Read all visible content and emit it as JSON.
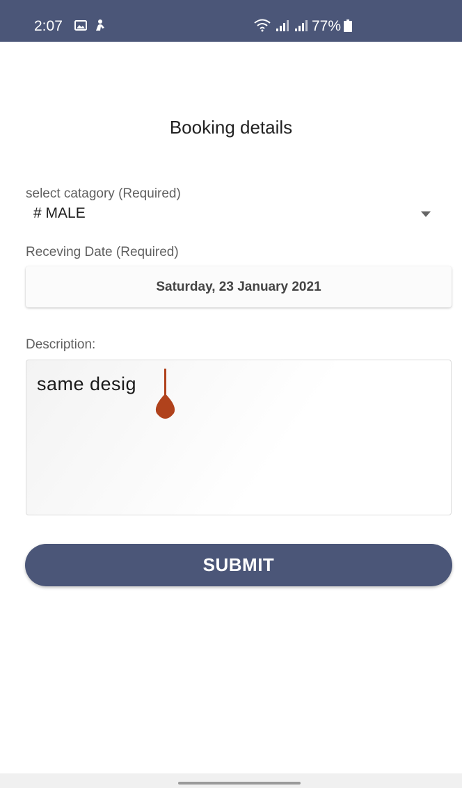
{
  "status_bar": {
    "time": "2:07",
    "battery_percent": "77%",
    "icons": [
      "gallery-icon",
      "person-icon",
      "wifi-icon",
      "signal-icon",
      "signal-icon",
      "battery-icon"
    ],
    "background_color": "#4b5678"
  },
  "page": {
    "title": "Booking details"
  },
  "category": {
    "label": "select catagory (Required)",
    "value": "# MALE",
    "icon": "dropdown-arrow-icon"
  },
  "date": {
    "label": "Receving Date (Required)",
    "value": "Saturday, 23 January 2021"
  },
  "description": {
    "label": "Description:",
    "value": "same desig",
    "caret_color": "#b0421c"
  },
  "submit": {
    "label": "SUBMIT",
    "color": "#4b5678"
  }
}
